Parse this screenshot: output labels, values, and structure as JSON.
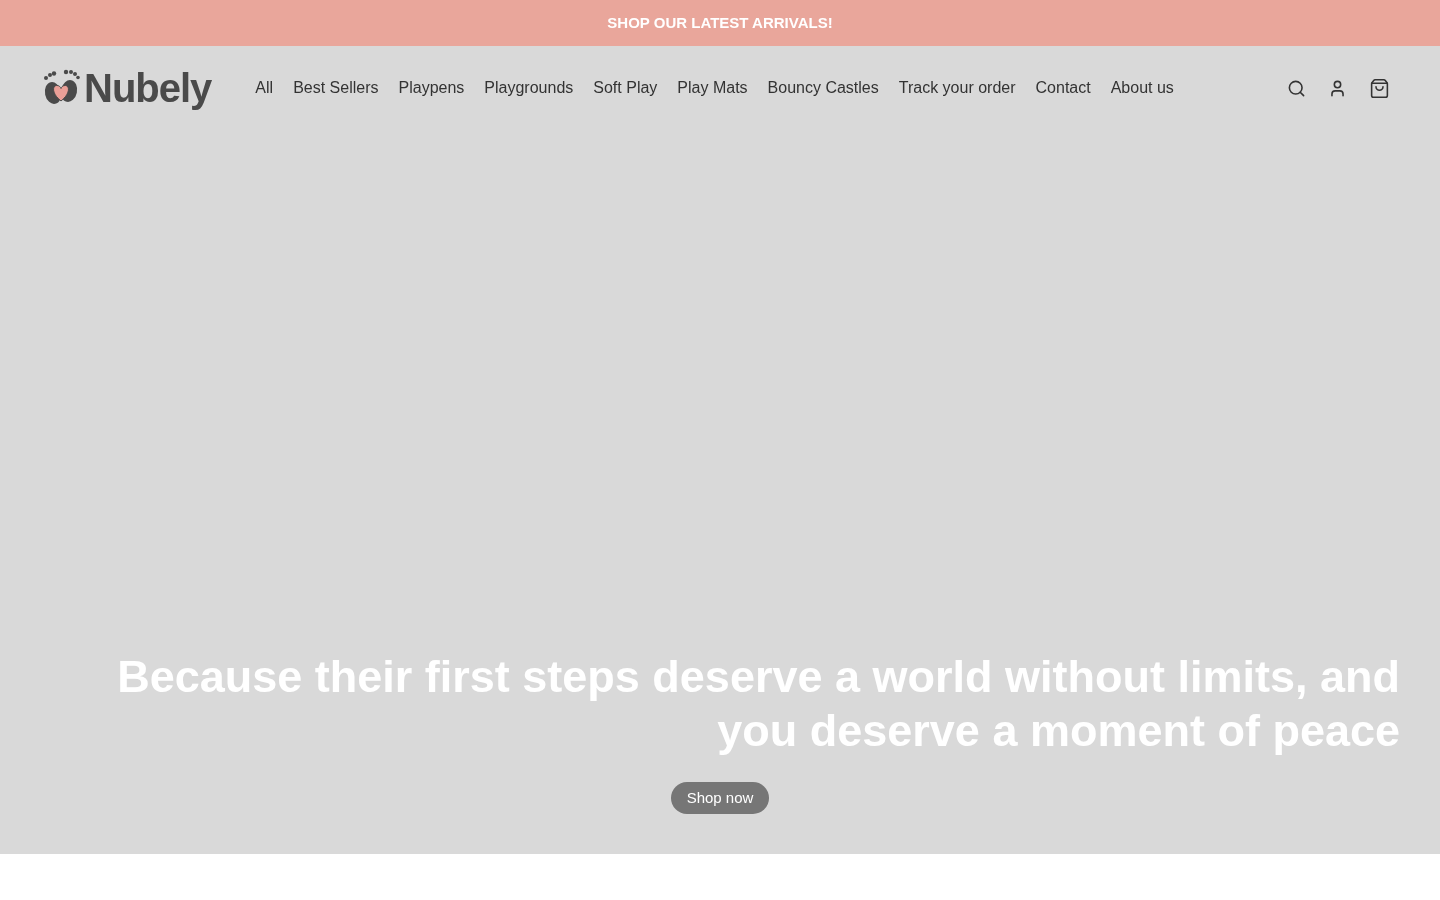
{
  "announcement": {
    "text": "SHOP OUR LATEST ARRIVALS!"
  },
  "header": {
    "logo": "Nubely",
    "nav": [
      "All",
      "Best Sellers",
      "Playpens",
      "Playgrounds",
      "Soft Play",
      "Play Mats",
      "Bouncy Castles",
      "Track your order",
      "Contact",
      "About us"
    ]
  },
  "hero": {
    "heading": "Because their first steps deserve a world without limits, and you deserve a moment of peace",
    "button": "Shop now"
  }
}
